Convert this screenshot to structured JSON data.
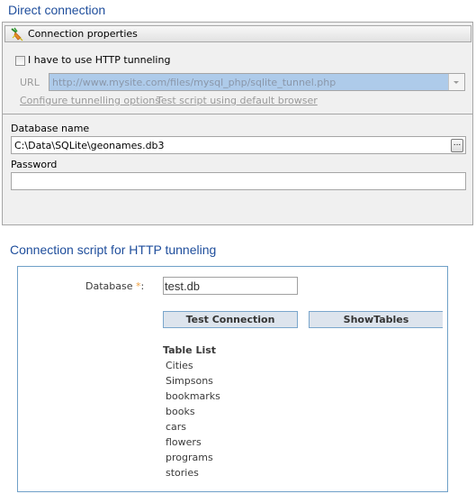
{
  "direct_connection": {
    "title": "Direct connection",
    "group_header": "Connection properties",
    "group_icon": "plug-icon",
    "http_tunneling_checkbox": {
      "label": "I have to use HTTP tunneling",
      "checked": false
    },
    "url": {
      "label": "URL",
      "value": "http://www.mysite.com/files/mysql_php/sqlite_tunnel.php",
      "enabled": false
    },
    "links": {
      "configure": "Configure tunnelling options",
      "test_script": "Test script using default browser"
    },
    "database_name": {
      "label": "Database name",
      "value": "C:\\Data\\SQLite\\geonames.db3",
      "browse_label": "..."
    },
    "password": {
      "label": "Password",
      "value": ""
    }
  },
  "http_tunneling": {
    "title": "Connection script for HTTP tunneling",
    "database": {
      "label": "Database",
      "required_mark": "*",
      "colon": ":",
      "value": "test.db"
    },
    "buttons": {
      "test_connection": "Test Connection",
      "show_tables": "ShowTables"
    },
    "table_list": {
      "heading": "Table List",
      "items": [
        "Cities",
        "Simpsons",
        "bookmarks",
        "books",
        "cars",
        "flowers",
        "programs",
        "stories"
      ]
    }
  },
  "colors": {
    "accent_title": "#1f4e9c",
    "box_border": "#6fa0c8",
    "url_selection": "#aecbea",
    "required_star": "#f0a040"
  }
}
